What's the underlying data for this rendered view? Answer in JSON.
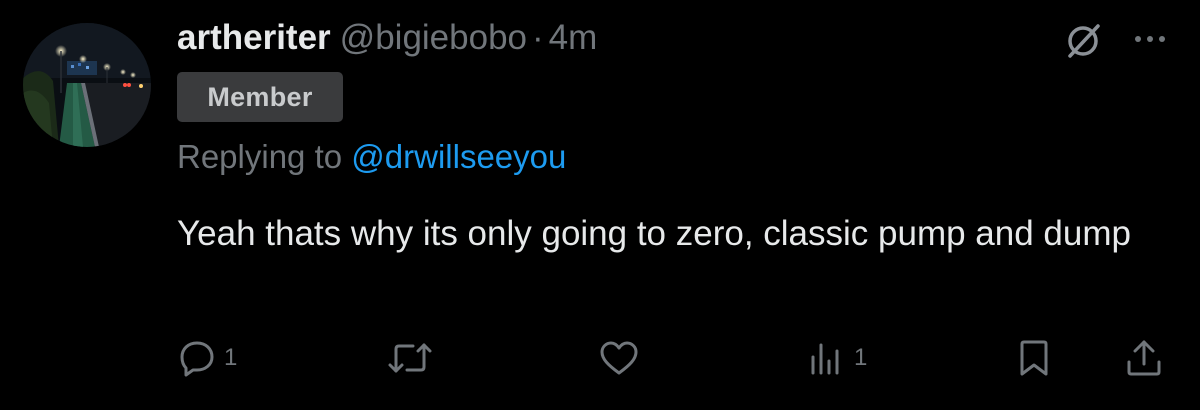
{
  "post": {
    "author": {
      "display_name": "artheriter",
      "handle": "@bigiebobo",
      "separator": "·",
      "time_ago": "4m",
      "badge": "Member"
    },
    "reply_context": {
      "prefix": "Replying to",
      "mention": "@drwillseeyou"
    },
    "text": "Yeah thats why its only going to zero, classic pump and dump",
    "actions": {
      "replies": "1",
      "reposts": "",
      "likes": "",
      "views": "1"
    }
  },
  "icons": {
    "header": [
      "grok-icon",
      "more-icon"
    ],
    "actions": [
      "reply-icon",
      "repost-icon",
      "like-icon",
      "views-icon",
      "bookmark-icon",
      "share-icon"
    ]
  },
  "colors": {
    "background": "#000000",
    "primary_text": "#e7e9ea",
    "secondary_text": "#71767b",
    "link": "#1d9bf0",
    "badge_bg": "#3a3b3d"
  }
}
